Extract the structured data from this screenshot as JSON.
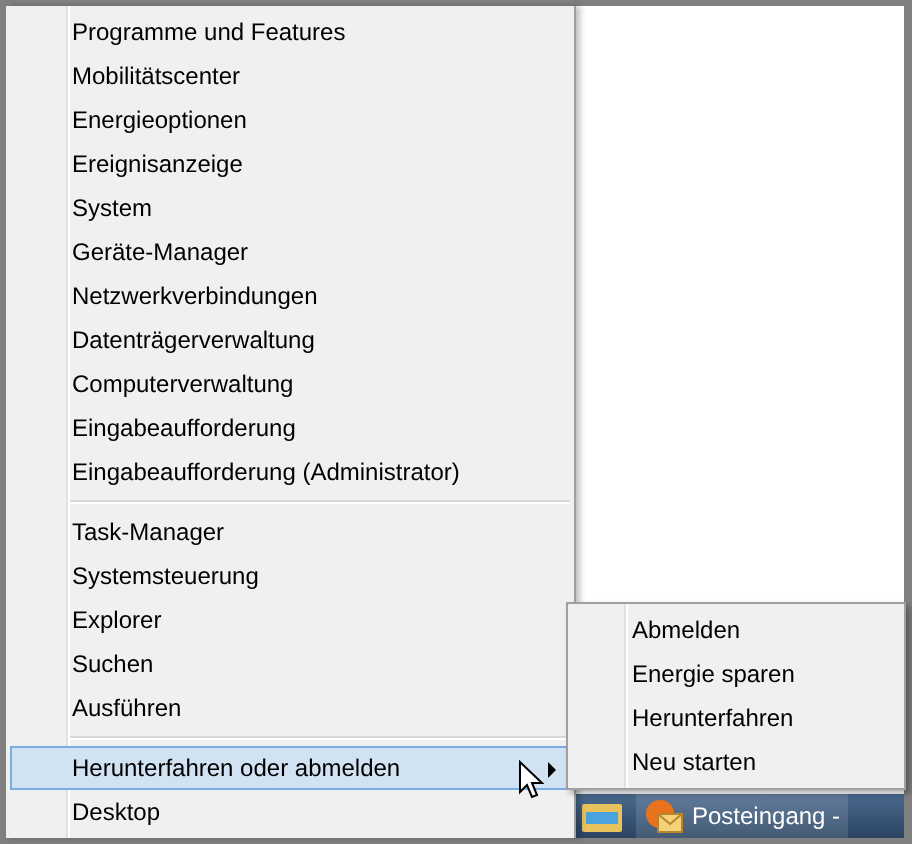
{
  "menu": {
    "groups": [
      {
        "items": [
          {
            "label": "Programme und Features",
            "selected": false,
            "submenu": false
          },
          {
            "label": "Mobilitätscenter",
            "selected": false,
            "submenu": false
          },
          {
            "label": "Energieoptionen",
            "selected": false,
            "submenu": false
          },
          {
            "label": "Ereignisanzeige",
            "selected": false,
            "submenu": false
          },
          {
            "label": "System",
            "selected": false,
            "submenu": false
          },
          {
            "label": "Geräte-Manager",
            "selected": false,
            "submenu": false
          },
          {
            "label": "Netzwerkverbindungen",
            "selected": false,
            "submenu": false
          },
          {
            "label": "Datenträgerverwaltung",
            "selected": false,
            "submenu": false
          },
          {
            "label": "Computerverwaltung",
            "selected": false,
            "submenu": false
          },
          {
            "label": "Eingabeaufforderung",
            "selected": false,
            "submenu": false
          },
          {
            "label": "Eingabeaufforderung (Administrator)",
            "selected": false,
            "submenu": false
          }
        ]
      },
      {
        "items": [
          {
            "label": "Task-Manager",
            "selected": false,
            "submenu": false
          },
          {
            "label": "Systemsteuerung",
            "selected": false,
            "submenu": false
          },
          {
            "label": "Explorer",
            "selected": false,
            "submenu": false
          },
          {
            "label": "Suchen",
            "selected": false,
            "submenu": false
          },
          {
            "label": "Ausführen",
            "selected": false,
            "submenu": false
          }
        ]
      },
      {
        "items": [
          {
            "label": "Herunterfahren oder abmelden",
            "selected": true,
            "submenu": true
          },
          {
            "label": "Desktop",
            "selected": false,
            "submenu": false
          }
        ]
      }
    ]
  },
  "submenu": {
    "items": [
      {
        "label": "Abmelden"
      },
      {
        "label": "Energie sparen"
      },
      {
        "label": "Herunterfahren"
      },
      {
        "label": "Neu starten"
      }
    ]
  },
  "taskbar": {
    "items": [
      {
        "kind": "icon"
      },
      {
        "kind": "app",
        "label": "Posteingang -"
      }
    ]
  }
}
